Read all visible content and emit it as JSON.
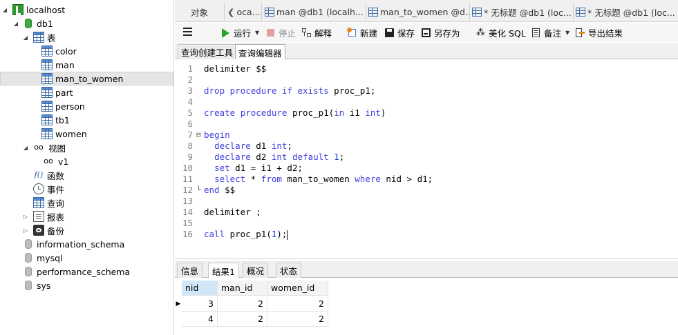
{
  "sidebar": {
    "connection": "localhost",
    "database": "db1",
    "tables_group": "表",
    "tables": [
      "color",
      "man",
      "man_to_women",
      "part",
      "person",
      "tb1",
      "women"
    ],
    "selected_table": "man_to_women",
    "views_group": "视图",
    "views": [
      "v1"
    ],
    "functions_group": "函数",
    "events_group": "事件",
    "queries_group": "查询",
    "reports_group": "报表",
    "backups_group": "备份",
    "other_databases": [
      "information_schema",
      "mysql",
      "performance_schema",
      "sys"
    ]
  },
  "tabs": {
    "objects": "对象",
    "items": [
      "oca...",
      "man @db1 (localh...",
      "man_to_women @d...",
      "* 无标题 @db1 (loc...",
      "* 无标题 @db1 (loc..."
    ]
  },
  "toolbar": {
    "run": "运行",
    "stop": "停止",
    "explain": "解释",
    "new": "新建",
    "save": "保存",
    "save_as": "另存为",
    "beautify": "美化 SQL",
    "comment": "备注",
    "export": "导出结果"
  },
  "subtabs": {
    "builder": "查询创建工具",
    "editor": "查询编辑器"
  },
  "editor": {
    "lines": [
      "delimiter $$",
      "",
      "drop procedure if exists proc_p1;",
      "",
      "create procedure proc_p1(in i1 int)",
      "",
      "begin",
      "  declare d1 int;",
      "  declare d2 int default 1;",
      "  set d1 = i1 + d2;",
      "  select * from man_to_women where nid > d1;",
      "end $$",
      "",
      "delimiter ;",
      "",
      "call proc_p1(1);"
    ]
  },
  "results": {
    "tabs": [
      "信息",
      "结果1",
      "概况",
      "状态"
    ],
    "active_tab": "结果1",
    "columns": [
      "nid",
      "man_id",
      "women_id"
    ],
    "rows": [
      [
        "3",
        "2",
        "2"
      ],
      [
        "4",
        "2",
        "2"
      ]
    ]
  },
  "colors": {
    "keyword": "#3f3fe0",
    "number": "#0a3fe0",
    "line_number": "#808080",
    "selected_row": "#e5e5e5",
    "selected_header": "#cfe7f9"
  }
}
